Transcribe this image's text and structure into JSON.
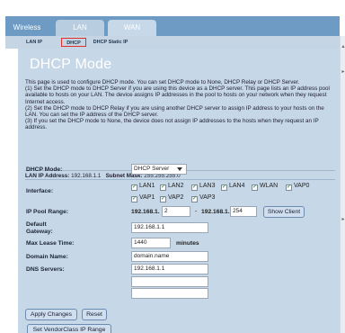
{
  "nav": {
    "tabs": [
      {
        "label": "Wireless"
      },
      {
        "label": "LAN"
      },
      {
        "label": "WAN"
      }
    ]
  },
  "subnav": {
    "items": [
      {
        "label": "LAN IP"
      },
      {
        "label": "DHCP"
      },
      {
        "label": "DHCP Static IP"
      }
    ]
  },
  "page": {
    "title": "DHCP Mode",
    "description": "This page is used to configure DHCP mode. You can set DHCP mode to None, DHCP Relay or DHCP Server.\n(1) Set the DHCP mode to DHCP Server if you are using this device as a DHCP server. This page lists an IP address pool available to hosts on your LAN. The device assigns IP addresses in the pool to hosts on your network when they request Internet access.\n(2) Set the DHCP mode to DHCP Relay if you are using another DHCP server to assign IP address to your hosts on the LAN. You can set the IP address of the DHCP server.\n(3) If you set the DHCP mode to None, the device does not assign IP addresses to the hosts when they request an IP address.",
    "lan_ip_label": "LAN IP Address:",
    "lan_ip_value": "192.168.1.1",
    "subnet_label": "Subnet Mask:",
    "subnet_value": "255.255.255.0"
  },
  "form": {
    "dhcp_mode": {
      "label": "DHCP Mode:",
      "value": "DHCP Server"
    },
    "interface": {
      "label": "Interface:",
      "options": [
        {
          "label": "LAN1",
          "checked": true
        },
        {
          "label": "LAN2",
          "checked": true
        },
        {
          "label": "LAN3",
          "checked": true
        },
        {
          "label": "LAN4",
          "checked": true
        },
        {
          "label": "WLAN",
          "checked": true
        },
        {
          "label": "VAP0",
          "checked": true
        },
        {
          "label": "VAP1",
          "checked": true
        },
        {
          "label": "VAP2",
          "checked": true
        },
        {
          "label": "VAP3",
          "checked": true
        }
      ]
    },
    "ip_pool": {
      "label": "IP Pool Range:",
      "prefix_start": "192.168.1.",
      "start": "2",
      "separator": "-",
      "prefix_end": "192.168.1.",
      "end": "254",
      "show_client_label": "Show Client"
    },
    "gateway": {
      "label_line1": "Default",
      "label_line2": "Gateway:",
      "value": "192.168.1.1"
    },
    "lease": {
      "label": "Max Lease Time:",
      "value": "1440",
      "unit": "minutes"
    },
    "domain": {
      "label": "Domain Name:",
      "value": "domain.name"
    },
    "dns": {
      "label": "DNS Servers:",
      "values": [
        "192.168.1.1",
        "",
        ""
      ]
    }
  },
  "buttons": {
    "apply": "Apply Changes",
    "reset": "Reset",
    "vendor": "Set VendorClass IP Range"
  },
  "colors": {
    "nav_bar": "#6d9bc3",
    "content_bg": "#c6d7e8",
    "active_sub_border": "#e0302c"
  }
}
